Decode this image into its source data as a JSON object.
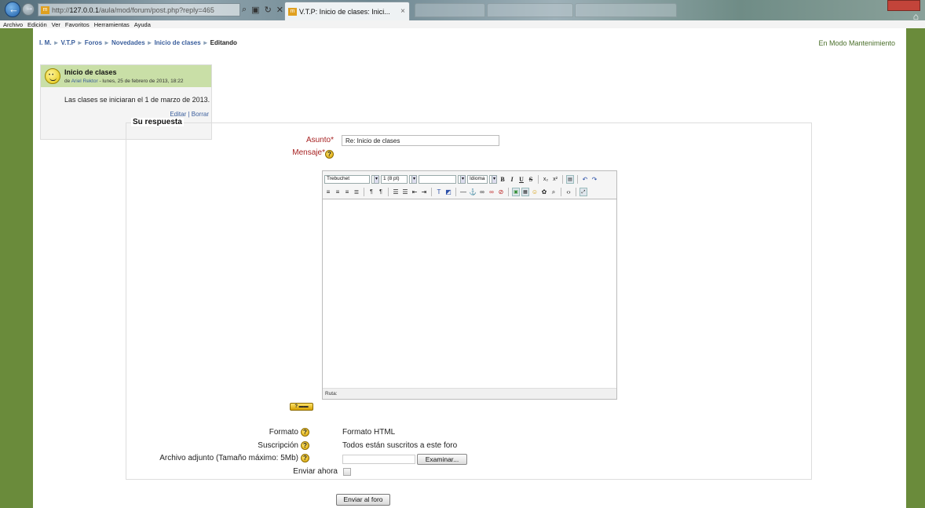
{
  "browser": {
    "url_host": "127.0.0.1",
    "url_prefix": "http://",
    "url_path": "/aula/mod/forum/post.php?reply=465",
    "tab_title": "V.T.P: Inicio de clases: Inici...",
    "tab_close": "×",
    "menu": [
      "Archivo",
      "Edición",
      "Ver",
      "Favoritos",
      "Herramientas",
      "Ayuda"
    ]
  },
  "breadcrumb": {
    "items": [
      "I. M.",
      "V.T.P",
      "Foros",
      "Novedades",
      "Inicio de clases"
    ],
    "current": "Editando",
    "separator": "►"
  },
  "maintenance_notice": "En Modo Mantenimiento",
  "post": {
    "subject": "Inicio de clases",
    "by": "de",
    "author": "Ariel Rektor",
    "date": " - lunes, 25 de febrero de 2013, 18:22",
    "body": "Las clases se iniciaran el 1 de marzo de 2013.",
    "edit_label": "Editar",
    "delete_label": "Borrar",
    "action_sep": " | "
  },
  "form": {
    "legend": "Su respuesta",
    "subject_label": "Asunto",
    "subject_value": "Re: Inicio de clases",
    "message_label": "Mensaje",
    "required_mark": "*",
    "editor": {
      "font": "Trebuchet",
      "size": "1 (8 pt)",
      "lang": "Idioma",
      "path_label": "Ruta:"
    },
    "format_label": "Formato",
    "format_value": "Formato HTML",
    "subscription_label": "Suscripción",
    "subscription_value": "Todos están suscritos a este foro",
    "attachment_label": "Archivo adjunto (Tamaño máximo: 5Mb)",
    "browse_label": "Examinar...",
    "send_now_label": "Enviar ahora",
    "help_glyph": "?",
    "submit_label": "Enviar al foro"
  }
}
